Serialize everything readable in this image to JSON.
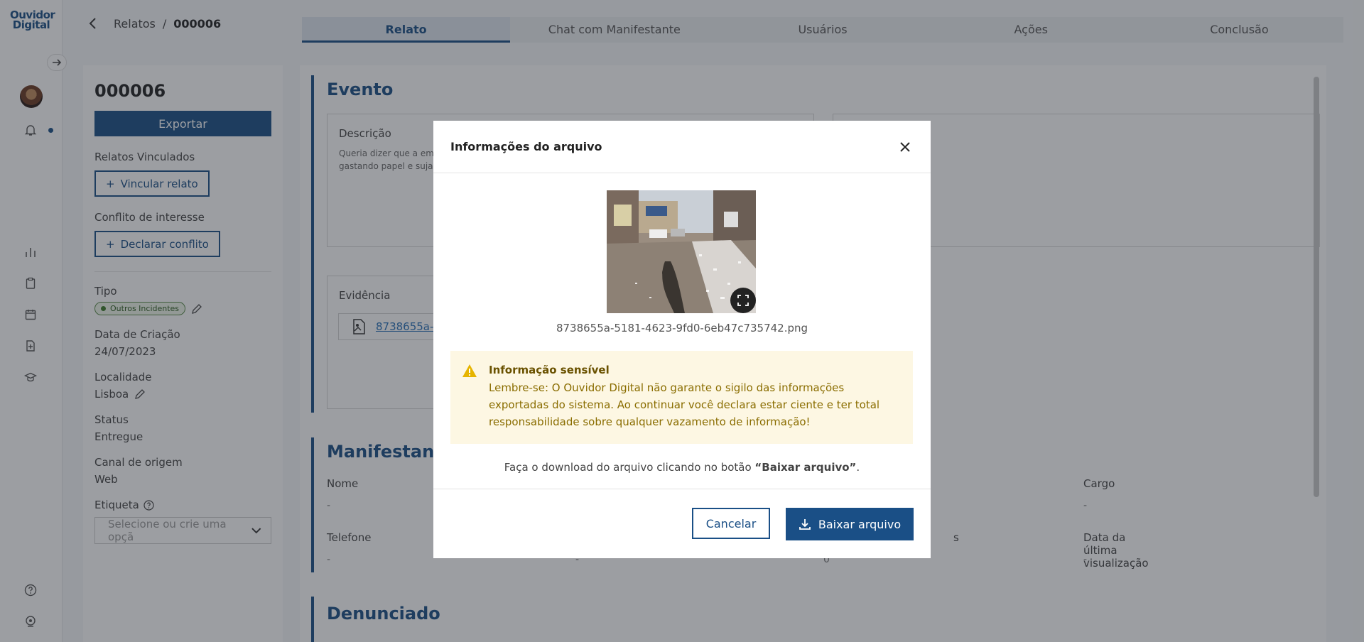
{
  "app": {
    "logo_line1": "Ouvidor",
    "logo_line2": "Digital"
  },
  "breadcrumb": {
    "parent": "Relatos",
    "separator": "/",
    "current": "000006"
  },
  "tabs": [
    {
      "label": "Relato",
      "active": true
    },
    {
      "label": "Chat com Manifestante",
      "active": false
    },
    {
      "label": "Usuários",
      "active": false
    },
    {
      "label": "Ações",
      "active": false
    },
    {
      "label": "Conclusão",
      "active": false
    }
  ],
  "info_panel": {
    "title": "000006",
    "export_label": "Exportar",
    "linked_label": "Relatos Vinculados",
    "link_button": "Vincular relato",
    "conflict_label": "Conflito de interesse",
    "conflict_button": "Declarar conflito",
    "type_label": "Tipo",
    "type_value": "Outros Incidentes",
    "created_label": "Data de Criação",
    "created_value": "24/07/2023",
    "locality_label": "Localidade",
    "locality_value": "Lisboa",
    "status_label": "Status",
    "status_value": "Entregue",
    "channel_label": "Canal de origem",
    "channel_value": "Web",
    "tag_label": "Etiqueta",
    "tag_placeholder": "Selecione ou crie uma opçã"
  },
  "main": {
    "event_title": "Evento",
    "description_title": "Descrição",
    "description_text_line1": "Queria dizer que a emp",
    "description_text_line2": "gastando papel e suja",
    "evidence_title": "Evidência",
    "evidence_link": "8738655a-",
    "manifestante_title": "Manifestante",
    "fields": {
      "nome_label": "Nome",
      "nome_value": "-",
      "cargo_label": "Cargo",
      "cargo_value": "-",
      "telefone_label": "Telefone",
      "telefone_value": "-",
      "col2_value": "-",
      "col3_label_fragment": "s",
      "col3_value": "0",
      "ultima_label": "Data da última visualização",
      "ultima_value": "-"
    },
    "denunciado_title": "Denunciado"
  },
  "modal": {
    "title": "Informações do arquivo",
    "filename": "8738655a-5181-4623-9fd0-6eb47c735742.png",
    "alert_title": "Informação sensível",
    "alert_body": "Lembre-se: O Ouvidor Digital não garante o sigilo das informações exportadas do sistema. Ao continuar você declara estar ciente e ter total responsabilidade sobre qualquer vazamento de informação!",
    "hint_prefix": "Faça o download do arquivo clicando no botão ",
    "hint_button": "“Baixar arquivo”",
    "hint_suffix": ".",
    "cancel_label": "Cancelar",
    "download_label": "Baixar arquivo"
  },
  "colors": {
    "brand": "#1a4f86",
    "alert_bg": "#fdf7e3",
    "alert_text": "#8a6d00"
  }
}
